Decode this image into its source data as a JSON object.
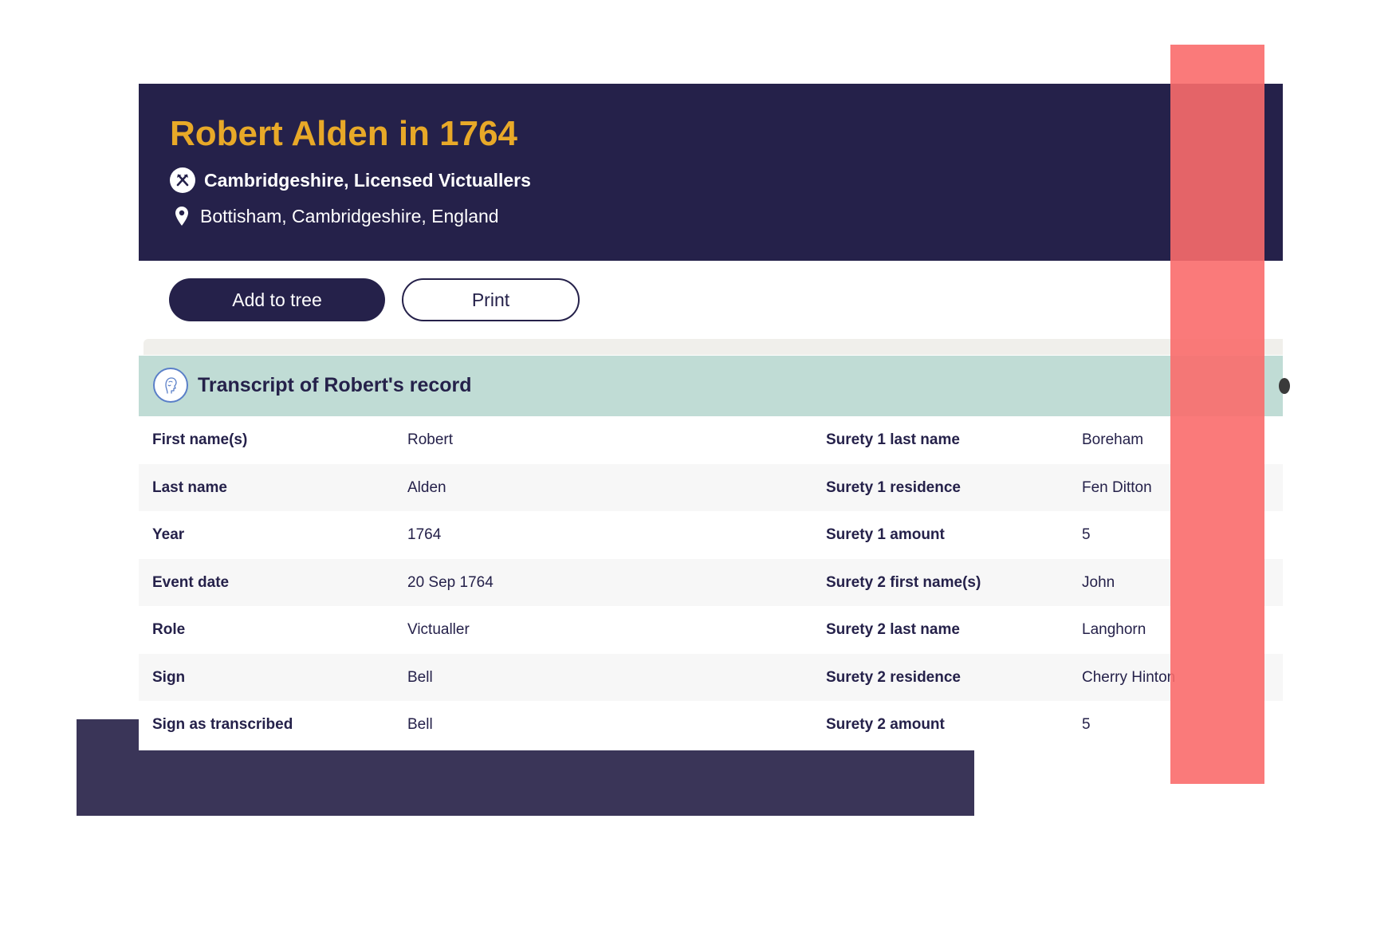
{
  "header": {
    "title": "Robert Alden in 1764",
    "collection": "Cambridgeshire, Licensed Victuallers",
    "location": "Bottisham, Cambridgeshire, England",
    "icons": {
      "collection": "tools-icon",
      "location": "map-pin-icon"
    }
  },
  "actions": {
    "add_to_tree": "Add to tree",
    "print": "Print"
  },
  "transcript": {
    "title": "Transcript of Robert's record",
    "icon": "portrait-icon",
    "rows": [
      {
        "label1": "First name(s)",
        "value1": "Robert",
        "label2": "Surety 1 last name",
        "value2": "Boreham"
      },
      {
        "label1": "Last name",
        "value1": "Alden",
        "label2": "Surety 1 residence",
        "value2": "Fen Ditton"
      },
      {
        "label1": "Year",
        "value1": "1764",
        "label2": "Surety 1 amount",
        "value2": "5"
      },
      {
        "label1": "Event date",
        "value1": "20 Sep 1764",
        "label2": "Surety 2 first name(s)",
        "value2": "John"
      },
      {
        "label1": "Role",
        "value1": "Victualler",
        "label2": "Surety 2 last name",
        "value2": "Langhorn"
      },
      {
        "label1": "Sign",
        "value1": "Bell",
        "label2": "Surety 2 residence",
        "value2": "Cherry Hinton"
      },
      {
        "label1": "Sign as transcribed",
        "value1": "Bell",
        "label2": "Surety 2 amount",
        "value2": "5"
      }
    ]
  },
  "colors": {
    "header_bg": "#25214a",
    "title": "#e8a928",
    "transcript_header_bg": "#c0dcd5",
    "row_alt_bg": "#f7f7f7",
    "overlay": "#f96c6c",
    "decorative_block": "#3a3558"
  }
}
